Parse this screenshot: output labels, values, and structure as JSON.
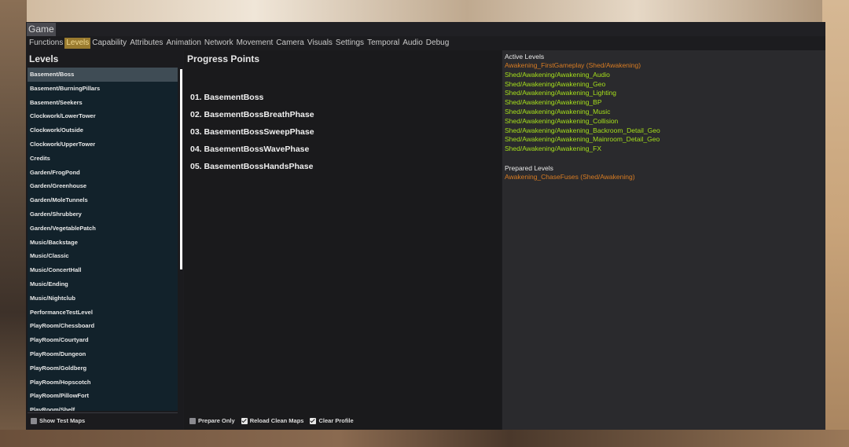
{
  "window": {
    "title": "Game"
  },
  "tabs": [
    {
      "label": "Functions",
      "active": false
    },
    {
      "label": "Levels",
      "active": true
    },
    {
      "label": "Capability",
      "active": false
    },
    {
      "label": "Attributes",
      "active": false
    },
    {
      "label": "Animation",
      "active": false
    },
    {
      "label": "Network",
      "active": false
    },
    {
      "label": "Movement",
      "active": false
    },
    {
      "label": "Camera",
      "active": false
    },
    {
      "label": "Visuals",
      "active": false
    },
    {
      "label": "Settings",
      "active": false
    },
    {
      "label": "Temporal",
      "active": false
    },
    {
      "label": "Audio",
      "active": false
    },
    {
      "label": "Debug",
      "active": false
    }
  ],
  "levels": {
    "heading": "Levels",
    "items": [
      "Basement/Boss",
      "Basement/BurningPillars",
      "Basement/Seekers",
      "Clockwork/LowerTower",
      "Clockwork/Outside",
      "Clockwork/UpperTower",
      "Credits",
      "Garden/FrogPond",
      "Garden/Greenhouse",
      "Garden/MoleTunnels",
      "Garden/Shrubbery",
      "Garden/VegetablePatch",
      "Music/Backstage",
      "Music/Classic",
      "Music/ConcertHall",
      "Music/Ending",
      "Music/Nightclub",
      "PerformanceTestLevel",
      "PlayRoom/Chessboard",
      "PlayRoom/Courtyard",
      "PlayRoom/Dungeon",
      "PlayRoom/Goldberg",
      "PlayRoom/Hopscotch",
      "PlayRoom/PillowFort",
      "PlayRoom/Shelf"
    ],
    "selected_index": 0,
    "show_test_maps": {
      "label": "Show Test Maps",
      "checked": false
    }
  },
  "progress": {
    "heading": "Progress Points",
    "items": [
      "01. BasementBoss",
      "02. BasementBossBreathPhase",
      "03. BasementBossSweepPhase",
      "04. BasementBossWavePhase",
      "05. BasementBossHandsPhase"
    ],
    "options": [
      {
        "label": "Prepare Only",
        "checked": false
      },
      {
        "label": "Reload Clean Maps",
        "checked": true
      },
      {
        "label": "Clear Profile",
        "checked": true
      }
    ]
  },
  "active_levels": {
    "heading": "Active Levels",
    "items": [
      {
        "text": "Awakening_FirstGameplay (Shed/Awakening)",
        "color": "#d97c22"
      },
      {
        "text": "Shed/Awakening/Awakening_Audio",
        "color": "#a6e01b"
      },
      {
        "text": "Shed/Awakening/Awakening_Geo",
        "color": "#a6e01b"
      },
      {
        "text": "Shed/Awakening/Awakening_Lighting",
        "color": "#a6e01b"
      },
      {
        "text": "Shed/Awakening/Awakening_BP",
        "color": "#a6e01b"
      },
      {
        "text": "Shed/Awakening/Awakening_Music",
        "color": "#a6e01b"
      },
      {
        "text": "Shed/Awakening/Awakening_Collision",
        "color": "#a6e01b"
      },
      {
        "text": "Shed/Awakening/Awakening_Backroom_Detail_Geo",
        "color": "#a6e01b"
      },
      {
        "text": "Shed/Awakening/Awakening_Mainroom_Detail_Geo",
        "color": "#a6e01b"
      },
      {
        "text": "Shed/Awakening/Awakening_FX",
        "color": "#a6e01b"
      }
    ]
  },
  "prepared_levels": {
    "heading": "Prepared Levels",
    "items": [
      {
        "text": "Awakening_ChaseFuses (Shed/Awakening)",
        "color": "#d97c22"
      }
    ]
  }
}
